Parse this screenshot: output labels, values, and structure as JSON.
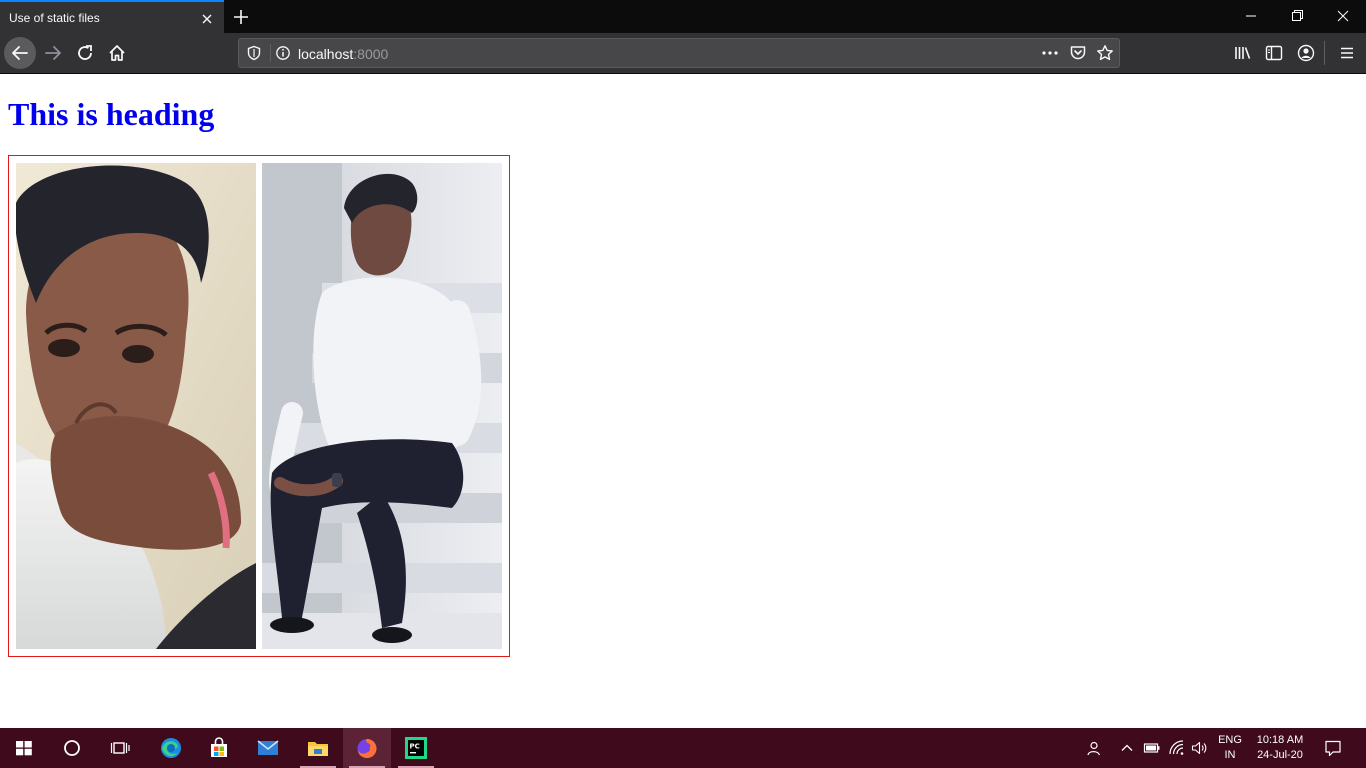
{
  "browser": {
    "tab": {
      "title": "Use of static files"
    },
    "address": {
      "host": "localhost",
      "port": ":8000"
    }
  },
  "page": {
    "heading": "This is heading"
  },
  "taskbar": {
    "language": {
      "line1": "ENG",
      "line2": "IN"
    },
    "clock": {
      "time": "10:18 AM",
      "date": "24-Jul-20"
    }
  }
}
